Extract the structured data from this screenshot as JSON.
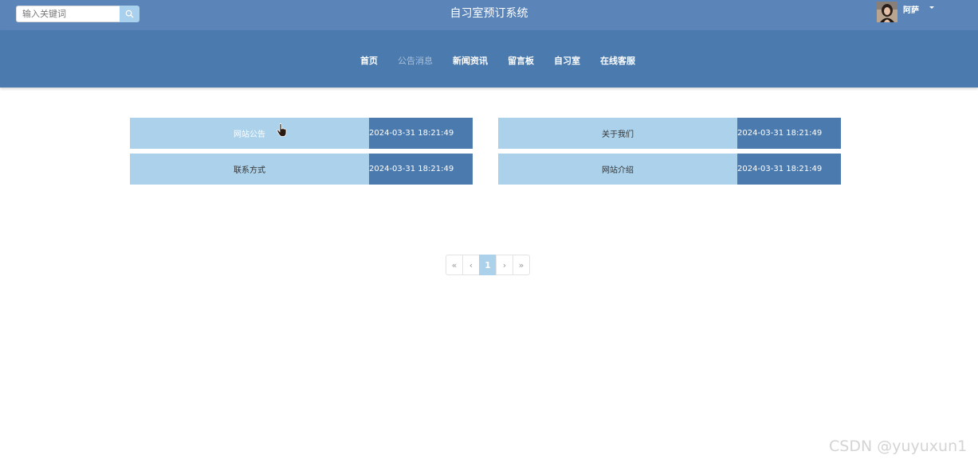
{
  "header": {
    "search_placeholder": "输入关键词",
    "title": "自习室预订系统",
    "username": "阿萨"
  },
  "nav": {
    "items": [
      {
        "label": "首页",
        "active": false
      },
      {
        "label": "公告消息",
        "active": true
      },
      {
        "label": "新闻资讯",
        "active": false
      },
      {
        "label": "留言板",
        "active": false
      },
      {
        "label": "自习室",
        "active": false
      },
      {
        "label": "在线客服",
        "active": false
      }
    ]
  },
  "cards": [
    {
      "title": "网站公告",
      "date": "2024-03-31 18:21:49"
    },
    {
      "title": "关于我们",
      "date": "2024-03-31 18:21:49"
    },
    {
      "title": "联系方式",
      "date": "2024-03-31 18:21:49"
    },
    {
      "title": "网站介绍",
      "date": "2024-03-31 18:21:49"
    }
  ],
  "pagination": {
    "first": "«",
    "prev": "‹",
    "current": "1",
    "next": "›",
    "last": "»"
  },
  "watermark": "CSDN @yuyuxun1",
  "colors": {
    "topbar": "#5b84b8",
    "navbar": "#4b7aae",
    "card_light": "#abd1eb",
    "card_dark": "#4b7aae"
  }
}
